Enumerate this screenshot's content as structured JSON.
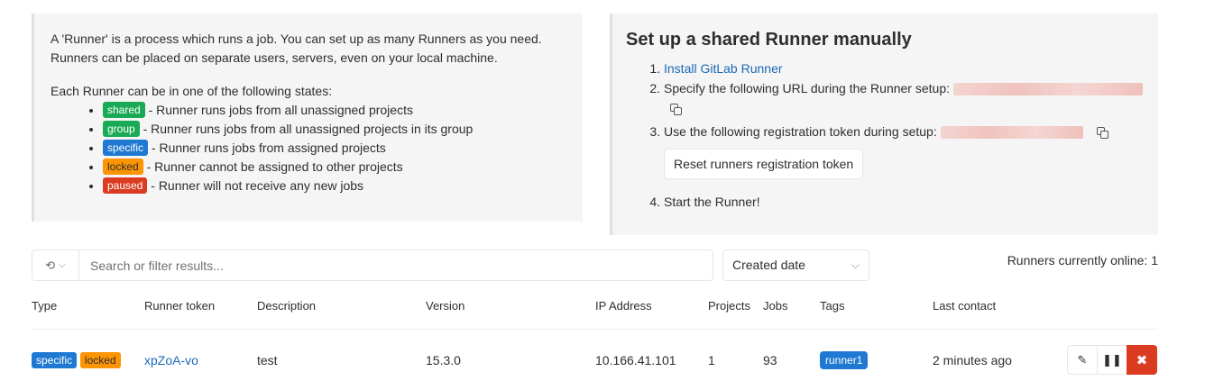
{
  "info": {
    "intro_line1": "A 'Runner' is a process which runs a job. You can set up as many Runners as you need.",
    "intro_line2": "Runners can be placed on separate users, servers, even on your local machine.",
    "states_title": "Each Runner can be in one of the following states:",
    "states": [
      {
        "badge": "shared",
        "text": "- Runner runs jobs from all unassigned projects",
        "color": "#1aaa55"
      },
      {
        "badge": "group",
        "text": "- Runner runs jobs from all unassigned projects in its group",
        "color": "#1aaa55"
      },
      {
        "badge": "specific",
        "text": "- Runner runs jobs from assigned projects",
        "color": "#1f78d1"
      },
      {
        "badge": "locked",
        "text": "- Runner cannot be assigned to other projects",
        "color": "#fc9403"
      },
      {
        "badge": "paused",
        "text": "- Runner will not receive any new jobs",
        "color": "#db3b21"
      }
    ]
  },
  "setup": {
    "title": "Set up a shared Runner manually",
    "step1_link": "Install GitLab Runner",
    "step2": "Specify the following URL during the Runner setup:",
    "step3": "Use the following registration token during setup:",
    "reset_button": "Reset runners registration token",
    "step4": "Start the Runner!"
  },
  "filter": {
    "placeholder": "Search or filter results...",
    "sort": "Created date",
    "online": "Runners currently online: 1"
  },
  "table": {
    "headers": [
      "Type",
      "Runner token",
      "Description",
      "Version",
      "IP Address",
      "Projects",
      "Jobs",
      "Tags",
      "Last contact"
    ],
    "row": {
      "badges": [
        "specific",
        "locked"
      ],
      "token": "xpZoA-vo",
      "description": "test",
      "version": "15.3.0",
      "ip": "10.166.41.101",
      "projects": "1",
      "jobs": "93",
      "tag": "runner1",
      "last_contact": "2 minutes ago"
    }
  },
  "icons": {
    "history": "history-icon",
    "copy": "copy-icon",
    "edit": "pencil-icon",
    "pause": "pause-icon",
    "remove": "close-icon"
  }
}
